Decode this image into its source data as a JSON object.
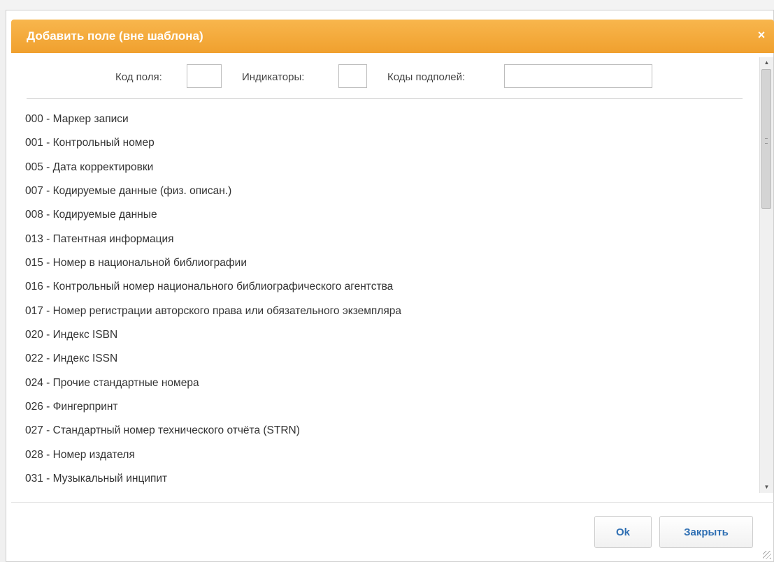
{
  "dialog": {
    "title": "Добавить поле (вне шаблона)",
    "close_symbol": "×",
    "colors": {
      "title_bg": "#f3a531",
      "title_text": "#ffffff",
      "button_text": "#2f6fb3"
    }
  },
  "filters": {
    "field_code": {
      "label": "Код поля:",
      "value": ""
    },
    "indicators": {
      "label": "Индикаторы:",
      "value": ""
    },
    "subfield_codes": {
      "label": "Коды подполей:",
      "value": ""
    }
  },
  "fields": [
    {
      "label": "000 - Маркер записи"
    },
    {
      "label": "001 - Контрольный номер"
    },
    {
      "label": "005 - Дата корректировки"
    },
    {
      "label": "007 - Кодируемые данные (физ. описан.)"
    },
    {
      "label": "008 - Кодируемые данные"
    },
    {
      "label": "013 - Патентная информация"
    },
    {
      "label": "015 - Номер в национальной библиографии"
    },
    {
      "label": "016 - Контрольный номер национального библиографического агентства"
    },
    {
      "label": "017 - Номер регистрации авторского права или обязательного экземпляра"
    },
    {
      "label": "020 - Индекс ISBN"
    },
    {
      "label": "022 - Индекс ISSN"
    },
    {
      "label": "024 - Прочие стандартные номера"
    },
    {
      "label": "026 - Фингерпринт"
    },
    {
      "label": "027 - Стандартный номер технического отчёта (STRN)"
    },
    {
      "label": "028 - Номер издателя"
    },
    {
      "label": "031 - Музыкальный инципит"
    }
  ],
  "buttons": {
    "ok": "Ok",
    "close": "Закрыть"
  }
}
